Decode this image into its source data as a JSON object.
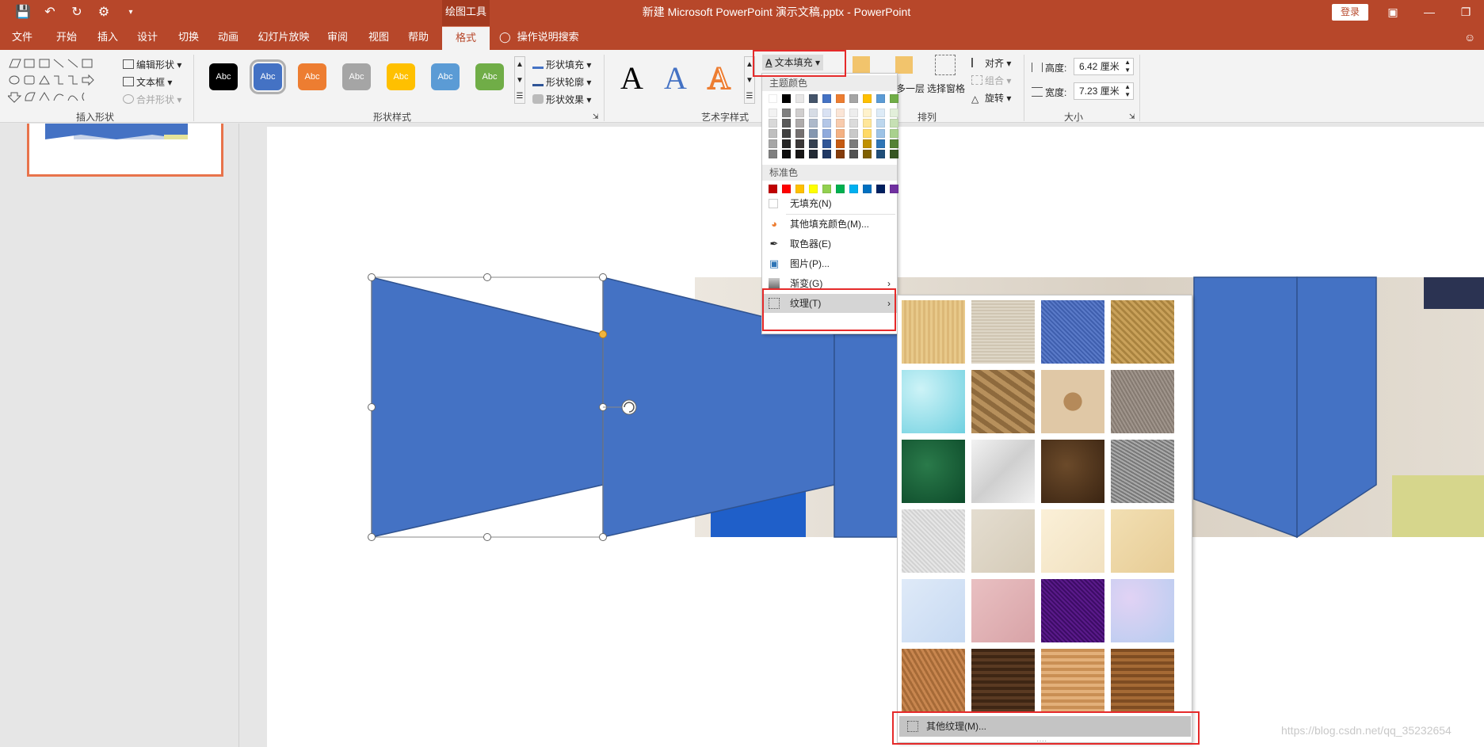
{
  "titlebar": {
    "drawing_tools": "绘图工具",
    "doc_title": "新建 Microsoft PowerPoint 演示文稿.pptx  -  PowerPoint",
    "login": "登录"
  },
  "tabs": [
    "文件",
    "开始",
    "插入",
    "设计",
    "切换",
    "动画",
    "幻灯片放映",
    "审阅",
    "视图",
    "帮助",
    "格式"
  ],
  "search_tab": "操作说明搜索",
  "ribbon": {
    "insert_shapes": {
      "edit_shape": "编辑形状",
      "text_box": "文本框",
      "merge_shapes": "合并形状",
      "label": "插入形状"
    },
    "shape_styles": {
      "preset_label": "Abc",
      "fill": "形状填充",
      "outline": "形状轮廓",
      "effects": "形状效果",
      "label": "形状样式",
      "preset_colors": [
        "#000000",
        "#4472c4",
        "#ed7d31",
        "#a5a5a5",
        "#ffc000",
        "#5b9bd5",
        "#70ad47"
      ]
    },
    "wordart": {
      "glyph": "A",
      "text_fill": "文本填充",
      "label": "艺术字样式"
    },
    "arrange": {
      "bring_forward": "多一层",
      "selection_pane": "选择窗格",
      "align": "对齐",
      "group": "组合",
      "rotate": "旋转",
      "label": "排列"
    },
    "size": {
      "height_label": "高度:",
      "height_value": "6.42 厘米",
      "width_label": "宽度:",
      "width_value": "7.23 厘米",
      "label": "大小"
    }
  },
  "fill_menu": {
    "theme_colors_header": "主题颜色",
    "standard_colors_header": "标准色",
    "theme_top_row": [
      "#ffffff",
      "#000000",
      "#e7e6e6",
      "#44546a",
      "#4472c4",
      "#ed7d31",
      "#a5a5a5",
      "#ffc000",
      "#5b9bd5",
      "#70ad47"
    ],
    "theme_tints": [
      [
        "#f2f2f2",
        "#7f7f7f",
        "#d0cece",
        "#d6dce5",
        "#d9e2f3",
        "#fbe5d6",
        "#ededed",
        "#fff2cc",
        "#ddebf7",
        "#e2efda"
      ],
      [
        "#d9d9d9",
        "#595959",
        "#aeabab",
        "#adb9ca",
        "#b4c7e7",
        "#f8cbad",
        "#dbdbdb",
        "#ffe699",
        "#bdd7ee",
        "#c6e0b4"
      ],
      [
        "#bfbfbf",
        "#404040",
        "#757171",
        "#8497b0",
        "#8faadc",
        "#f4b183",
        "#c9c9c9",
        "#ffd966",
        "#9dc3e6",
        "#a9d18e"
      ],
      [
        "#a6a6a6",
        "#262626",
        "#3b3838",
        "#333f50",
        "#2f5597",
        "#c55a11",
        "#7b7b7b",
        "#bf9000",
        "#2e75b6",
        "#548235"
      ],
      [
        "#7f7f7f",
        "#0d0d0d",
        "#171616",
        "#222a35",
        "#1f3864",
        "#843c0c",
        "#525252",
        "#7f6000",
        "#1f4e79",
        "#375623"
      ]
    ],
    "standard_colors": [
      "#c00000",
      "#ff0000",
      "#ffc000",
      "#ffff00",
      "#92d050",
      "#00b050",
      "#00b0f0",
      "#0070c0",
      "#002060",
      "#7030a0"
    ],
    "no_fill": "无填充(N)",
    "more_colors": "其他填充颜色(M)...",
    "eyedropper": "取色器(E)",
    "picture": "图片(P)...",
    "gradient": "渐变(G)",
    "texture": "纹理(T)"
  },
  "texture_panel": {
    "more_textures": "其他纹理(M)...",
    "textures": [
      "papyrus",
      "canvas",
      "denim",
      "woven-mat",
      "water-droplets",
      "paper-bag",
      "fish-fossil",
      "sand",
      "green-marble",
      "white-marble",
      "brown-marble",
      "granite",
      "newsprint",
      "recycled-paper",
      "parchment",
      "stationery",
      "blue-tissue-paper",
      "pink-tissue-paper",
      "purple-mesh",
      "bouquet",
      "cork",
      "walnut",
      "oak",
      "medium-wood"
    ]
  },
  "watermark": "https://blog.csdn.net/qq_35232654"
}
